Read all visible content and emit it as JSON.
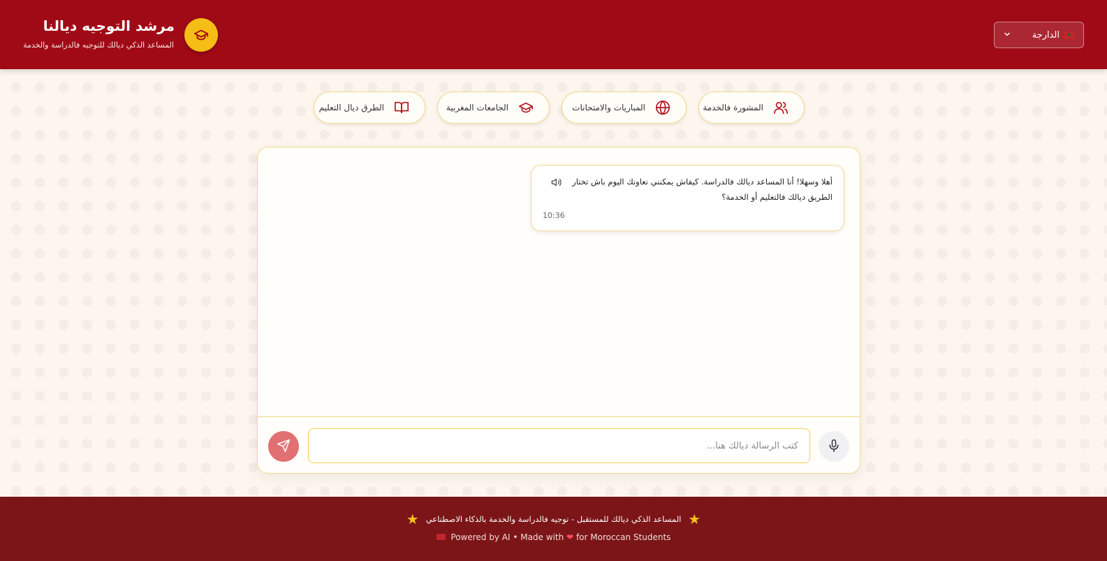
{
  "header": {
    "title": "مرشد التوجيه ديالنا",
    "subtitle": "المساعد الذكي ديالك للتوجيه فالدراسة والخدمة",
    "language_selected": "الدارجة",
    "language_flag": "morocco-flag-icon"
  },
  "quick_actions": [
    {
      "label": "المشورة فالخدمة",
      "icon": "users-icon"
    },
    {
      "label": "المباريات والامتحانات",
      "icon": "globe-icon"
    },
    {
      "label": "الجامعات المغربية",
      "icon": "graduation-cap-icon"
    },
    {
      "label": "الطرق ديال التعليم",
      "icon": "open-book-icon"
    }
  ],
  "chat": {
    "messages": [
      {
        "sender": "assistant",
        "text": "أهلا وسهلا! أنا المساعد ديالك فالدراسة. كيفاش يمكنني نعاونك اليوم باش تختار الطريق ديالك فالتعليم أو الخدمة؟",
        "time": "10:36"
      }
    ],
    "input_placeholder": "كتب الرسالة ديالك هنا...",
    "input_value": ""
  },
  "footer": {
    "line1": "المساعد الذكي ديالك للمستقبل - توجيه فالدراسة والخدمة بالذكاء الاصطناعي",
    "line2_part1": "Powered by AI • Made with",
    "line2_part2": "for Moroccan Students"
  },
  "colors": {
    "header_bg": "#a00a16",
    "accent_gold": "#f6bd16",
    "footer_bg": "#7b1518",
    "card_border": "#f2d98a",
    "send_button": "#e07072"
  }
}
